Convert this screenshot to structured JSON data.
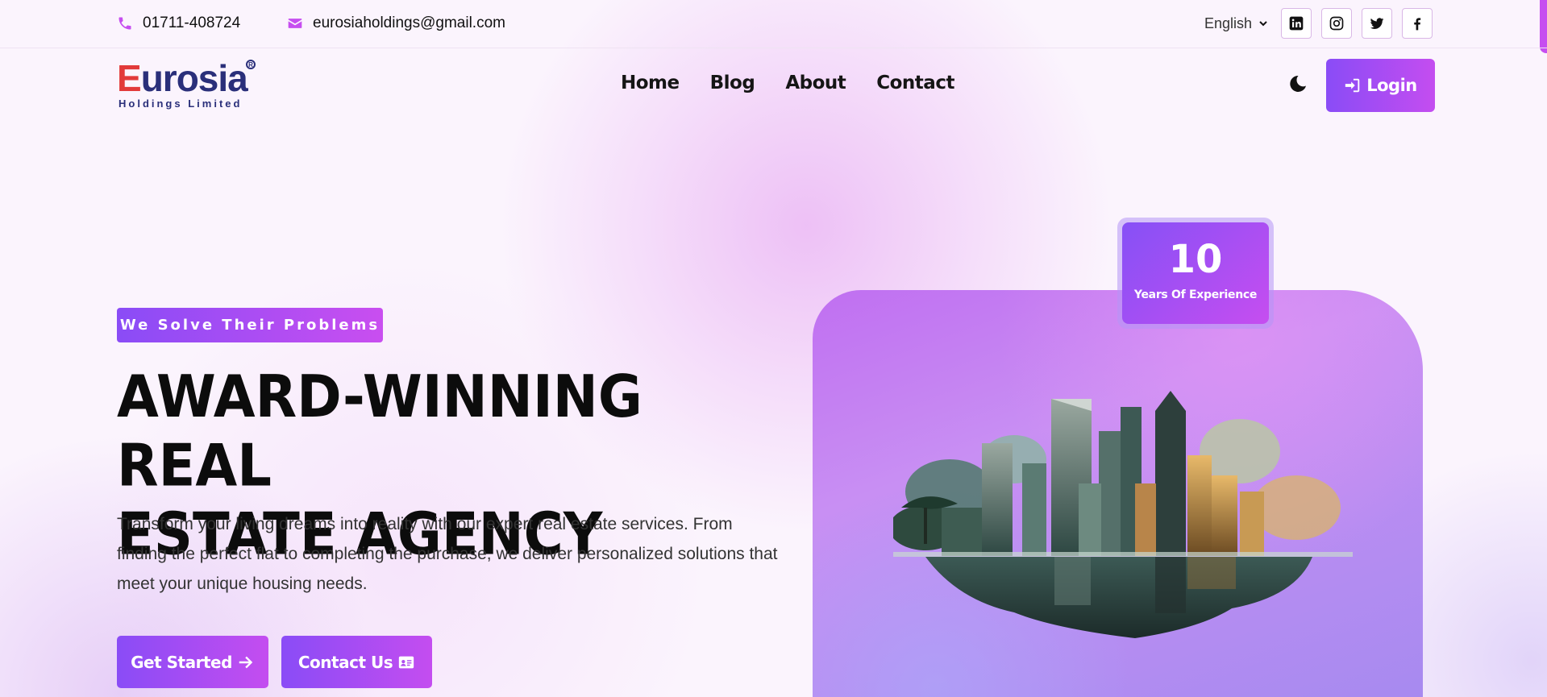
{
  "topbar": {
    "phone": "01711-408724",
    "email": "eurosiaholdings@gmail.com",
    "language": "English",
    "socials": [
      "linkedin-icon",
      "instagram-icon",
      "twitter-icon",
      "facebook-icon"
    ]
  },
  "brand": {
    "name_e": "E",
    "name_rest": "urosia",
    "registered": "R",
    "tagline": "Holdings Limited"
  },
  "nav": {
    "items": [
      {
        "label": "Home"
      },
      {
        "label": "Blog"
      },
      {
        "label": "About"
      },
      {
        "label": "Contact"
      }
    ],
    "login_label": "Login"
  },
  "hero": {
    "badge": "We Solve Their Problems",
    "headline_line1": "AWARD-WINNING REAL",
    "headline_line2": "ESTATE AGENCY",
    "description": "Transform your living dreams into reality with our expert real estate services. From finding the perfect flat to completing the purchase, we deliver personalized solutions that meet your unique housing needs.",
    "cta_primary": "Get Started",
    "cta_secondary": "Contact Us",
    "experience_value": "10",
    "experience_label": "Years Of Experience"
  },
  "colors": {
    "accent": "#c64ef0",
    "gradient_start": "#8a4cf6",
    "gradient_end": "#c44df0",
    "brand_navy": "#2a2f7a",
    "brand_red": "#e23a3a"
  }
}
